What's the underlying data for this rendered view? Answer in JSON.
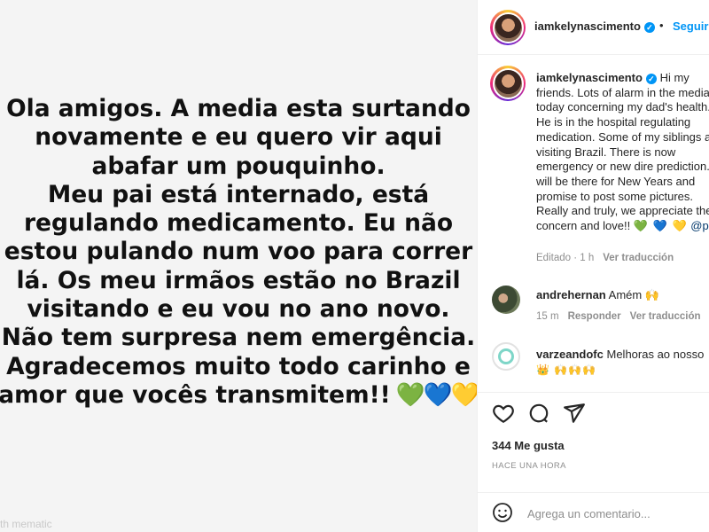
{
  "story": {
    "text": "Ola amigos. A media esta surtando\nnovamente e eu quero vir aqui\nabafar um pouquinho.\nMeu pai está internado, está\nregulando medicamento. Eu não\nestou pulando num voo para correr\nlá. Os meu irmãos estão no Brazil\nvisitando e eu vou no ano novo.\nNão tem surpresa nem emergência.\nAgradecemos muito todo carinho e\namor que vocês transmitem!!",
    "hearts": [
      "💚",
      "💙",
      "💛"
    ],
    "watermark": "th mematic"
  },
  "header": {
    "username": "iamkelynascimento",
    "separator": "•",
    "follow_label": "Seguir"
  },
  "caption": {
    "username": "iamkelynascimento",
    "text": "Hi my friends. Lots of alarm in the media today concerning my dad's health. He is in the hospital regulating medication. Some of my siblings are visiting Brazil. There is now emergency or new dire prediction. I will be there for New Years and promise to post some pictures.\nReally and truly, we appreciate the concern and love!!",
    "hearts": "💚 💙 💛",
    "mention": "@p",
    "meta_edited": "Editado · 1 h",
    "meta_translate": "Ver traducción"
  },
  "comments": [
    {
      "username": "andrehernan",
      "text": "Amém",
      "emoji": "🙌",
      "time": "15 m",
      "reply_label": "Responder",
      "translate_label": "Ver traducción"
    },
    {
      "username": "varzeandofc",
      "text": "Melhoras ao nosso",
      "emoji": "👑 🙌🙌🙌"
    }
  ],
  "actions": {
    "likes": "344 Me gusta",
    "time_ago": "HACE UNA HORA"
  },
  "add_comment": {
    "placeholder": "Agrega un comentario..."
  },
  "colors": {
    "accent": "#0095f6",
    "muted": "#8e8e8e",
    "text": "#262626"
  }
}
